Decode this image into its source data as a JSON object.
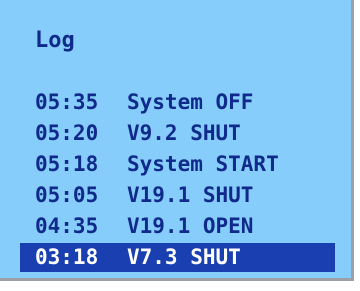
{
  "panel": {
    "title": "Log"
  },
  "entries": [
    {
      "time": "05:35",
      "message": "System OFF"
    },
    {
      "time": "05:20",
      "message": "V9.2 SHUT"
    },
    {
      "time": "05:18",
      "message": "System START"
    },
    {
      "time": "05:05",
      "message": "V19.1 SHUT"
    },
    {
      "time": "04:35",
      "message": "V19.1 OPEN"
    },
    {
      "time": "03:18",
      "message": "V7.3 SHUT"
    }
  ],
  "selected_index": 5,
  "colors": {
    "background": "#87cdfb",
    "text": "#0f2a8a",
    "selection": "#1a3fb0",
    "selection_text": "#ffffff"
  }
}
